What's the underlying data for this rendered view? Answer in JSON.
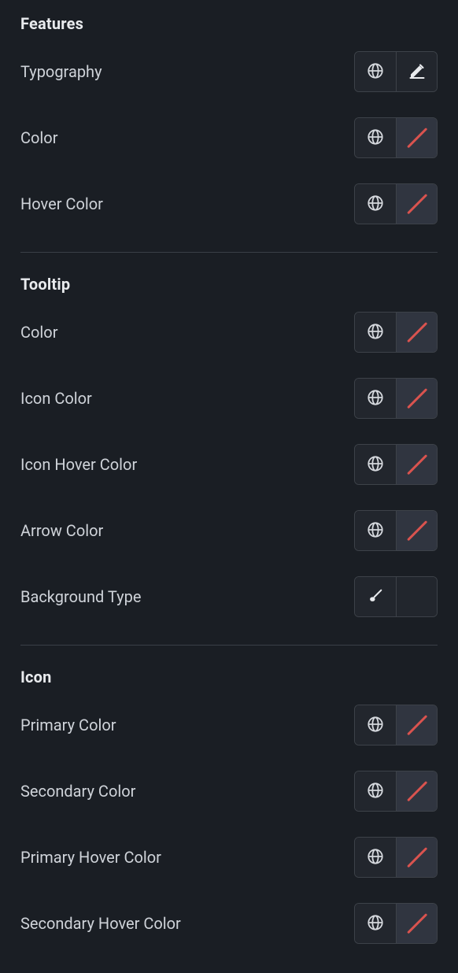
{
  "sections": {
    "features": {
      "title": "Features",
      "typography": "Typography",
      "color": "Color",
      "hover_color": "Hover Color"
    },
    "tooltip": {
      "title": "Tooltip",
      "color": "Color",
      "icon_color": "Icon Color",
      "icon_hover_color": "Icon Hover Color",
      "arrow_color": "Arrow Color",
      "background_type": "Background Type"
    },
    "icon": {
      "title": "Icon",
      "primary_color": "Primary Color",
      "secondary_color": "Secondary Color",
      "primary_hover_color": "Primary Hover Color",
      "secondary_hover_color": "Secondary Hover Color"
    }
  }
}
